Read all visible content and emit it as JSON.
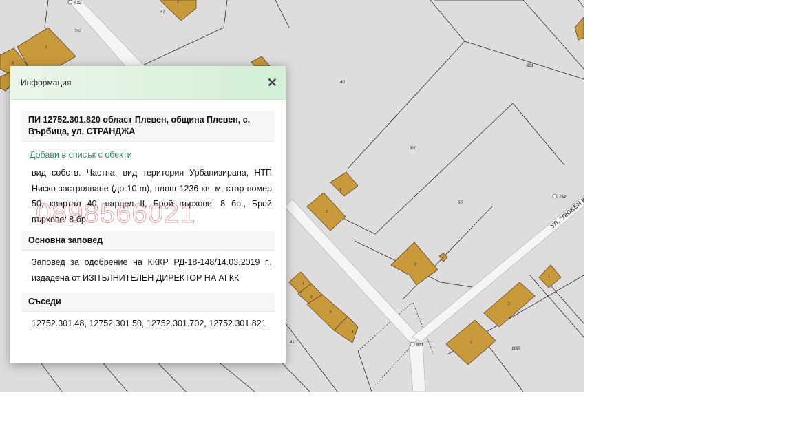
{
  "panel": {
    "title": "Информация",
    "close_icon": "close-icon",
    "parcel_heading": "ПИ 12752.301.820 област Плевен, община Плевен, с. Върбица, ул. СТРАНДЖА",
    "add_link": "Добави в списък с обекти",
    "description": "вид собств. Частна, вид територия Урбанизирана, НТП Ниско застрояване (до 10 m), площ 1236 кв. м, стар номер 50, квартал 40, парцел II, Брой върхове: 8 бр., Брой върхове: 8 бр.",
    "decree_heading": "Основна заповед",
    "decree_text": "Заповед за одобрение на КККР РД-18-148/14.03.2019 г., издадена от ИЗПЪЛНИТЕЛЕН ДИРЕКТОР НА АГКК",
    "neighbors_heading": "Съседи",
    "neighbors": [
      "12752.301.48,",
      "12752.301.50,",
      "12752.301.702,",
      "12752.301.821"
    ]
  },
  "watermark": "0898566021",
  "map": {
    "street_label": "УЛ. \"ЛЮБЕН КАРАВЕЛОВ\"",
    "point_labels": [
      "632",
      "764",
      "631"
    ],
    "parcel_labels": [
      "47",
      "702",
      "40",
      "821",
      "820",
      "50",
      "1185",
      "41"
    ],
    "building_labels": [
      "2",
      "1",
      "3",
      "4",
      "1",
      "2",
      "3",
      "1",
      "2",
      "3",
      "4",
      "3",
      "4",
      "2",
      "3",
      "1"
    ],
    "colors": {
      "background": "#dedcdc",
      "building": "#c99a3c",
      "road": "#f5f5f5",
      "panel_header": "#d3efd6",
      "link": "#3a8a5c"
    }
  }
}
